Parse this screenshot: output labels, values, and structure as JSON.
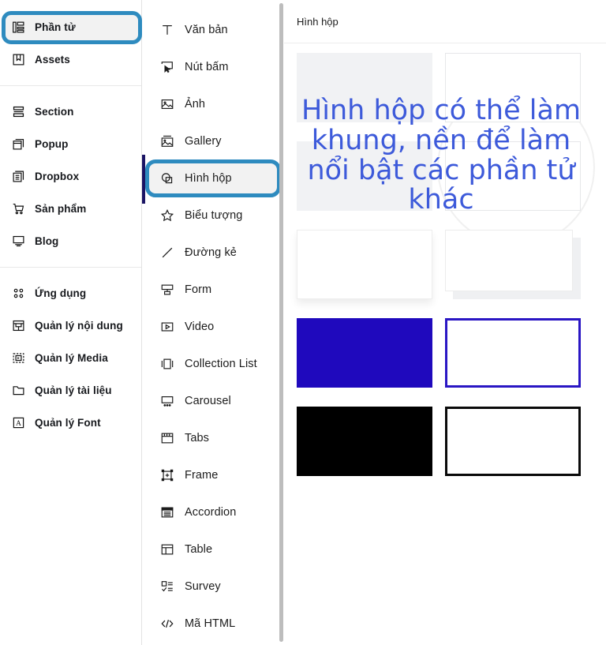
{
  "sidebar": {
    "groups": [
      {
        "items": [
          {
            "label": "Phần tử",
            "icon": "elements-icon",
            "selected": true
          },
          {
            "label": "Assets",
            "icon": "assets-bookmark-icon",
            "selected": false
          }
        ]
      },
      {
        "items": [
          {
            "label": "Section",
            "icon": "section-icon",
            "selected": false
          },
          {
            "label": "Popup",
            "icon": "popup-icon",
            "selected": false
          },
          {
            "label": "Dropbox",
            "icon": "dropbox-icon",
            "selected": false
          },
          {
            "label": "Sản phẩm",
            "icon": "cart-icon",
            "selected": false
          },
          {
            "label": "Blog",
            "icon": "blog-monitor-icon",
            "selected": false
          }
        ]
      },
      {
        "items": [
          {
            "label": "Ứng dụng",
            "icon": "apps-grid-icon",
            "selected": false
          },
          {
            "label": "Quản lý nội dung",
            "icon": "content-manager-icon",
            "selected": false
          },
          {
            "label": "Quản lý Media",
            "icon": "media-manager-icon",
            "selected": false
          },
          {
            "label": "Quản lý tài liệu",
            "icon": "folder-icon",
            "selected": false
          },
          {
            "label": "Quản lý Font",
            "icon": "font-manager-icon",
            "selected": false
          }
        ]
      }
    ]
  },
  "elements_panel": {
    "items": [
      {
        "label": "Văn bản",
        "icon": "text-icon",
        "selected": false
      },
      {
        "label": "Nút bấm",
        "icon": "button-cursor-icon",
        "selected": false
      },
      {
        "label": "Ảnh",
        "icon": "image-icon",
        "selected": false
      },
      {
        "label": "Gallery",
        "icon": "gallery-icon",
        "selected": false
      },
      {
        "label": "Hình hộp",
        "icon": "shape-box-icon",
        "selected": true
      },
      {
        "label": "Biểu tượng",
        "icon": "star-icon",
        "selected": false
      },
      {
        "label": "Đường kẻ",
        "icon": "line-icon",
        "selected": false
      },
      {
        "label": "Form",
        "icon": "form-icon",
        "selected": false
      },
      {
        "label": "Video",
        "icon": "video-play-icon",
        "selected": false
      },
      {
        "label": "Collection List",
        "icon": "collection-list-icon",
        "selected": false
      },
      {
        "label": "Carousel",
        "icon": "carousel-icon",
        "selected": false
      },
      {
        "label": "Tabs",
        "icon": "tabs-icon",
        "selected": false
      },
      {
        "label": "Frame",
        "icon": "frame-icon",
        "selected": false
      },
      {
        "label": "Accordion",
        "icon": "accordion-icon",
        "selected": false
      },
      {
        "label": "Table",
        "icon": "table-icon",
        "selected": false
      },
      {
        "label": "Survey",
        "icon": "survey-icon",
        "selected": false
      },
      {
        "label": "Mã HTML",
        "icon": "code-html-icon",
        "selected": false
      }
    ]
  },
  "preview_panel": {
    "title": "Hình hộp",
    "overlay_caption": "Hình hộp có thể làm khung, nền để làm nổi bật các phần tử khác",
    "shape_rows": [
      [
        {
          "name": "filled-gray-box",
          "style": "s-fill-gray"
        },
        {
          "name": "outline-light-box",
          "style": "s-outline-lt"
        }
      ],
      [
        {
          "name": "filled-gray-box-2",
          "style": "s-fill-gray"
        },
        {
          "name": "outline-light-box-2",
          "style": "s-outline-lt"
        }
      ],
      [
        {
          "name": "shadow-box",
          "style": "s-outline-sh"
        },
        {
          "name": "offset-shadow-box",
          "style": "s-offset"
        }
      ],
      [
        {
          "name": "filled-blue-box",
          "style": "s-fill-blue"
        },
        {
          "name": "blue-border-box",
          "style": "s-border-blue"
        }
      ],
      [
        {
          "name": "filled-black-box",
          "style": "s-fill-black"
        },
        {
          "name": "black-border-box",
          "style": "s-border-black"
        }
      ]
    ]
  },
  "colors": {
    "selection_ring": "#2e8bbf",
    "selection_fill": "#f2f2f2",
    "navy_marker": "#1b1464",
    "overlay_text": "#3d5ada",
    "shape_blue": "#1f09bd",
    "shape_border_blue": "#2a16c4",
    "shape_black": "#000000",
    "panel_gray": "#f1f2f4"
  }
}
